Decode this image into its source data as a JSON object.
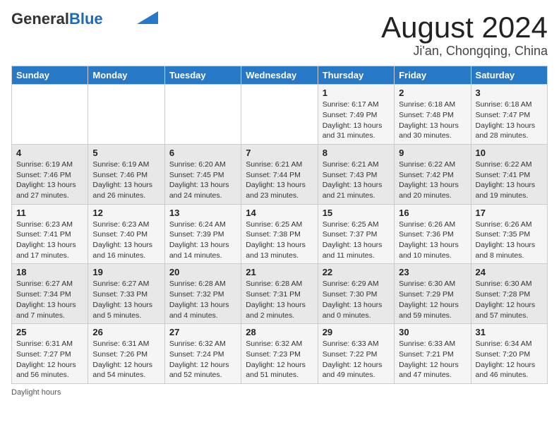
{
  "header": {
    "logo_general": "General",
    "logo_blue": "Blue",
    "month_title": "August 2024",
    "location": "Ji'an, Chongqing, China"
  },
  "days_of_week": [
    "Sunday",
    "Monday",
    "Tuesday",
    "Wednesday",
    "Thursday",
    "Friday",
    "Saturday"
  ],
  "weeks": [
    [
      {
        "day": "",
        "info": ""
      },
      {
        "day": "",
        "info": ""
      },
      {
        "day": "",
        "info": ""
      },
      {
        "day": "",
        "info": ""
      },
      {
        "day": "1",
        "info": "Sunrise: 6:17 AM\nSunset: 7:49 PM\nDaylight: 13 hours\nand 31 minutes."
      },
      {
        "day": "2",
        "info": "Sunrise: 6:18 AM\nSunset: 7:48 PM\nDaylight: 13 hours\nand 30 minutes."
      },
      {
        "day": "3",
        "info": "Sunrise: 6:18 AM\nSunset: 7:47 PM\nDaylight: 13 hours\nand 28 minutes."
      }
    ],
    [
      {
        "day": "4",
        "info": "Sunrise: 6:19 AM\nSunset: 7:46 PM\nDaylight: 13 hours\nand 27 minutes."
      },
      {
        "day": "5",
        "info": "Sunrise: 6:19 AM\nSunset: 7:46 PM\nDaylight: 13 hours\nand 26 minutes."
      },
      {
        "day": "6",
        "info": "Sunrise: 6:20 AM\nSunset: 7:45 PM\nDaylight: 13 hours\nand 24 minutes."
      },
      {
        "day": "7",
        "info": "Sunrise: 6:21 AM\nSunset: 7:44 PM\nDaylight: 13 hours\nand 23 minutes."
      },
      {
        "day": "8",
        "info": "Sunrise: 6:21 AM\nSunset: 7:43 PM\nDaylight: 13 hours\nand 21 minutes."
      },
      {
        "day": "9",
        "info": "Sunrise: 6:22 AM\nSunset: 7:42 PM\nDaylight: 13 hours\nand 20 minutes."
      },
      {
        "day": "10",
        "info": "Sunrise: 6:22 AM\nSunset: 7:41 PM\nDaylight: 13 hours\nand 19 minutes."
      }
    ],
    [
      {
        "day": "11",
        "info": "Sunrise: 6:23 AM\nSunset: 7:41 PM\nDaylight: 13 hours\nand 17 minutes."
      },
      {
        "day": "12",
        "info": "Sunrise: 6:23 AM\nSunset: 7:40 PM\nDaylight: 13 hours\nand 16 minutes."
      },
      {
        "day": "13",
        "info": "Sunrise: 6:24 AM\nSunset: 7:39 PM\nDaylight: 13 hours\nand 14 minutes."
      },
      {
        "day": "14",
        "info": "Sunrise: 6:25 AM\nSunset: 7:38 PM\nDaylight: 13 hours\nand 13 minutes."
      },
      {
        "day": "15",
        "info": "Sunrise: 6:25 AM\nSunset: 7:37 PM\nDaylight: 13 hours\nand 11 minutes."
      },
      {
        "day": "16",
        "info": "Sunrise: 6:26 AM\nSunset: 7:36 PM\nDaylight: 13 hours\nand 10 minutes."
      },
      {
        "day": "17",
        "info": "Sunrise: 6:26 AM\nSunset: 7:35 PM\nDaylight: 13 hours\nand 8 minutes."
      }
    ],
    [
      {
        "day": "18",
        "info": "Sunrise: 6:27 AM\nSunset: 7:34 PM\nDaylight: 13 hours\nand 7 minutes."
      },
      {
        "day": "19",
        "info": "Sunrise: 6:27 AM\nSunset: 7:33 PM\nDaylight: 13 hours\nand 5 minutes."
      },
      {
        "day": "20",
        "info": "Sunrise: 6:28 AM\nSunset: 7:32 PM\nDaylight: 13 hours\nand 4 minutes."
      },
      {
        "day": "21",
        "info": "Sunrise: 6:28 AM\nSunset: 7:31 PM\nDaylight: 13 hours\nand 2 minutes."
      },
      {
        "day": "22",
        "info": "Sunrise: 6:29 AM\nSunset: 7:30 PM\nDaylight: 13 hours\nand 0 minutes."
      },
      {
        "day": "23",
        "info": "Sunrise: 6:30 AM\nSunset: 7:29 PM\nDaylight: 12 hours\nand 59 minutes."
      },
      {
        "day": "24",
        "info": "Sunrise: 6:30 AM\nSunset: 7:28 PM\nDaylight: 12 hours\nand 57 minutes."
      }
    ],
    [
      {
        "day": "25",
        "info": "Sunrise: 6:31 AM\nSunset: 7:27 PM\nDaylight: 12 hours\nand 56 minutes."
      },
      {
        "day": "26",
        "info": "Sunrise: 6:31 AM\nSunset: 7:26 PM\nDaylight: 12 hours\nand 54 minutes."
      },
      {
        "day": "27",
        "info": "Sunrise: 6:32 AM\nSunset: 7:24 PM\nDaylight: 12 hours\nand 52 minutes."
      },
      {
        "day": "28",
        "info": "Sunrise: 6:32 AM\nSunset: 7:23 PM\nDaylight: 12 hours\nand 51 minutes."
      },
      {
        "day": "29",
        "info": "Sunrise: 6:33 AM\nSunset: 7:22 PM\nDaylight: 12 hours\nand 49 minutes."
      },
      {
        "day": "30",
        "info": "Sunrise: 6:33 AM\nSunset: 7:21 PM\nDaylight: 12 hours\nand 47 minutes."
      },
      {
        "day": "31",
        "info": "Sunrise: 6:34 AM\nSunset: 7:20 PM\nDaylight: 12 hours\nand 46 minutes."
      }
    ]
  ],
  "footer": {
    "label": "Daylight hours"
  }
}
